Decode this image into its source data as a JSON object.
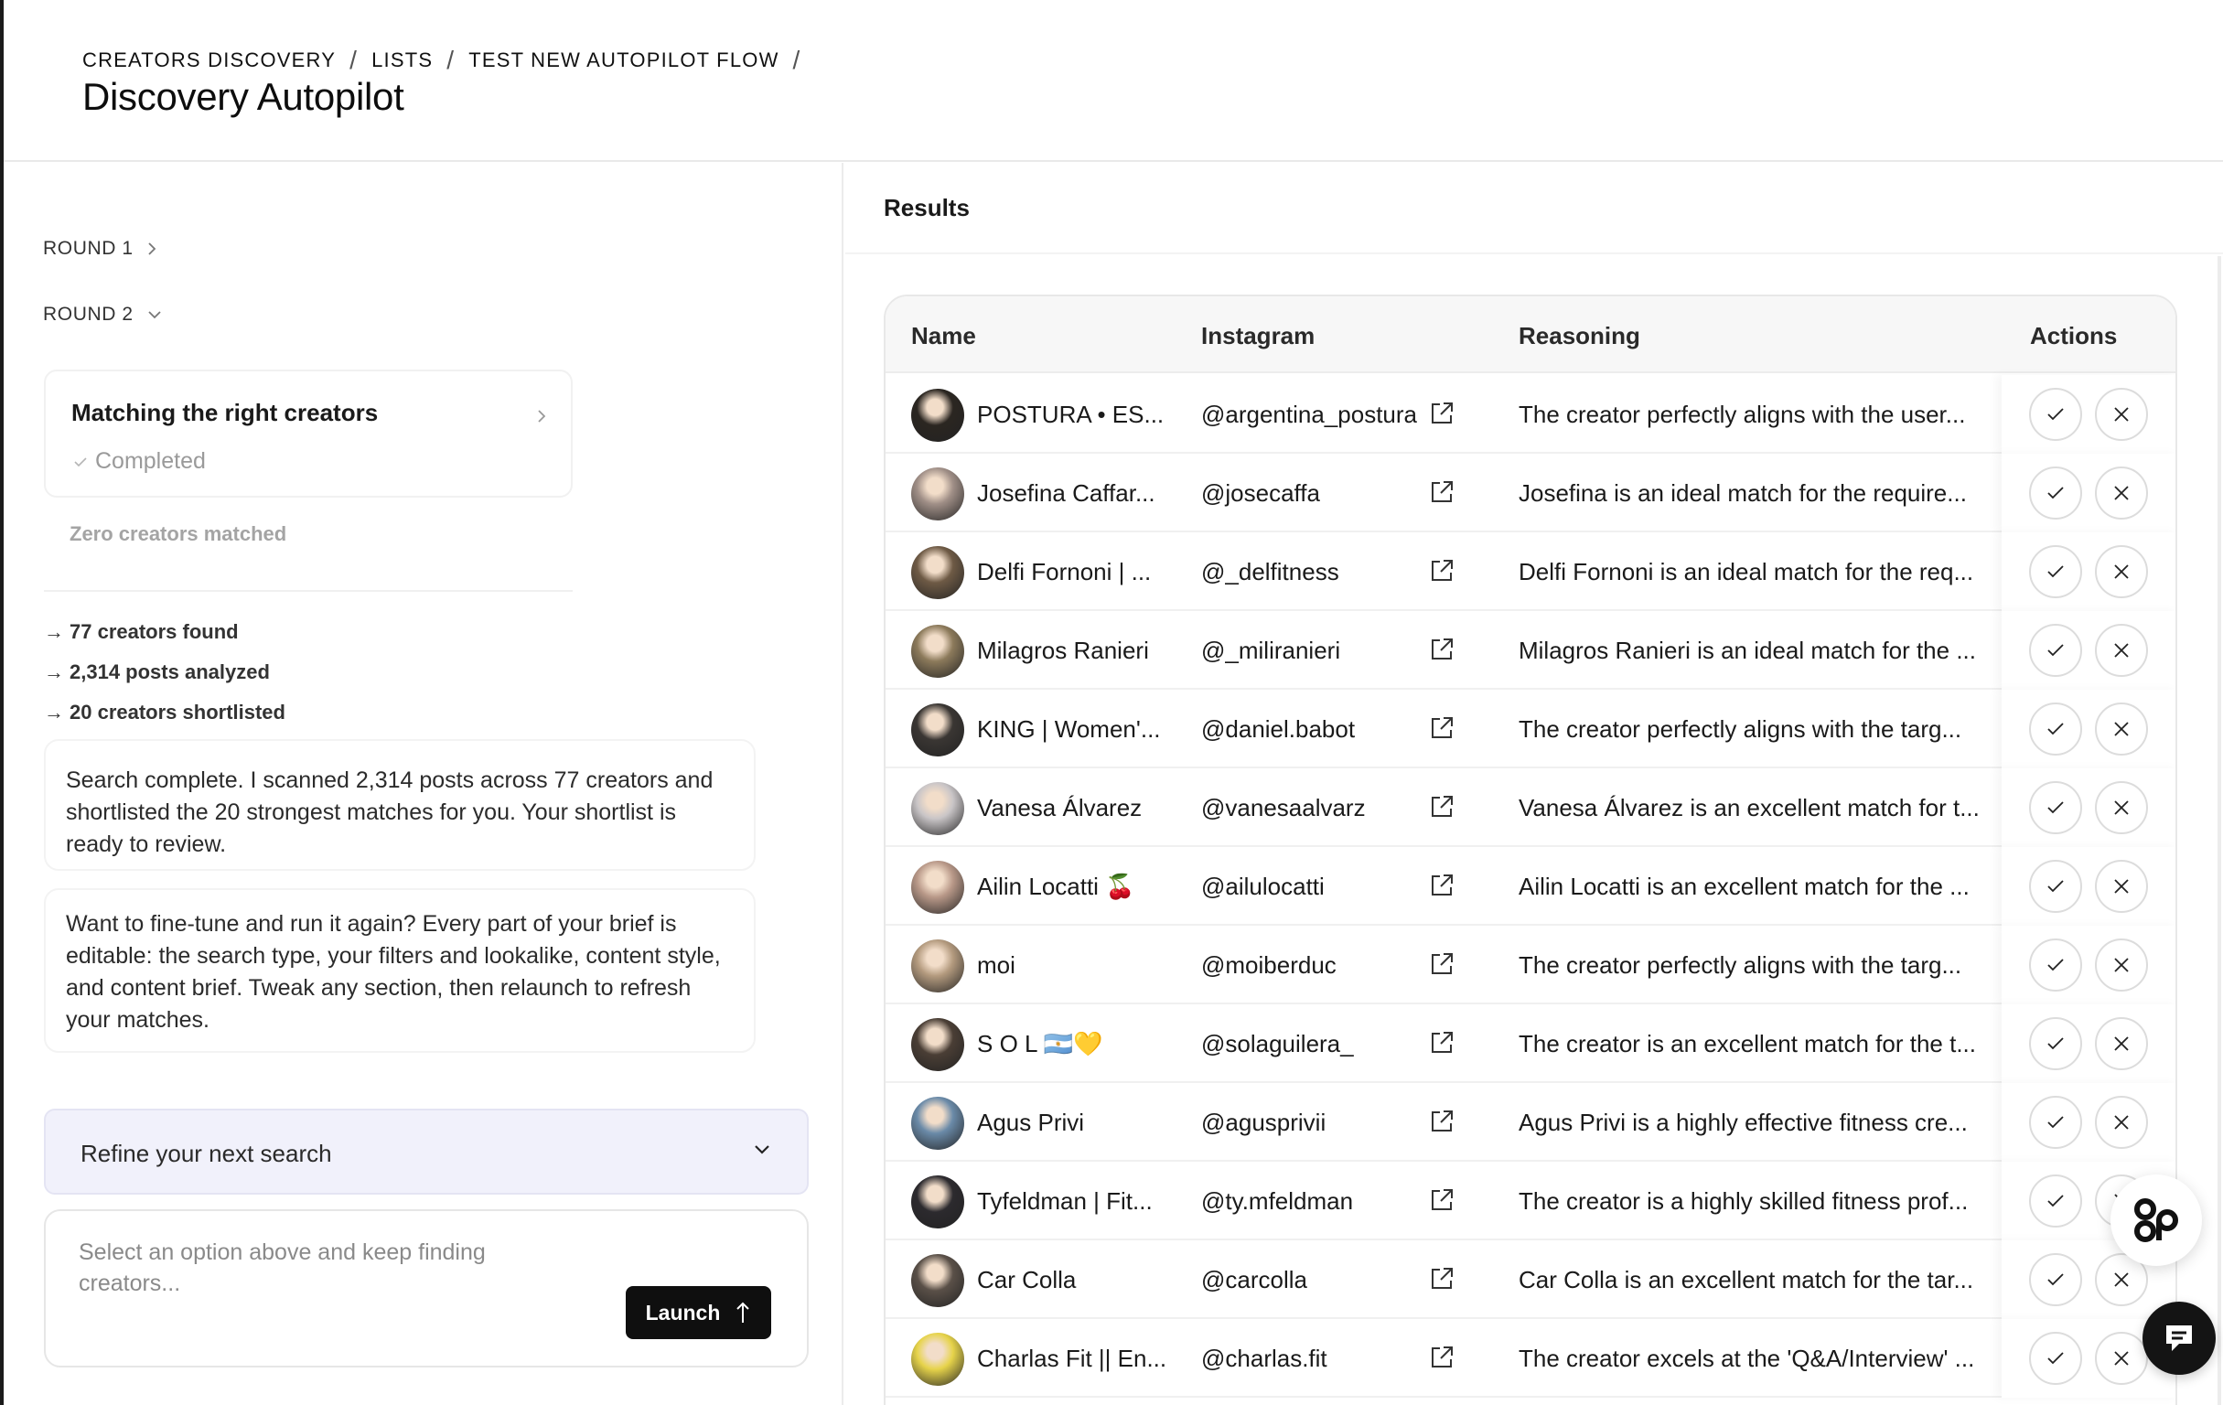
{
  "breadcrumb": [
    "CREATORS DISCOVERY",
    "LISTS",
    "TEST NEW AUTOPILOT FLOW"
  ],
  "breadcrumb_separator": "/",
  "page_title": "Discovery Autopilot",
  "rounds": [
    {
      "label": "ROUND 1",
      "expanded": false
    },
    {
      "label": "ROUND 2",
      "expanded": true
    }
  ],
  "matching_card": {
    "title": "Matching the right creators",
    "status": "Completed"
  },
  "zero_matched": "Zero creators matched",
  "stats": [
    "77 creators found",
    "2,314 posts analyzed",
    "20 creators shortlisted"
  ],
  "messages": [
    "Search complete. I scanned 2,314 posts across 77 creators and shortlisted the 20 strongest matches for you. Your shortlist is ready to review.",
    "Want to fine-tune and run it again? Every part of your brief is editable: the search type, your filters and lookalike, content style, and content brief. Tweak any section, then relaunch to refresh your matches."
  ],
  "refine": {
    "label": "Refine your next search"
  },
  "composer": {
    "placeholder": "Select an option above and keep finding creators...",
    "launch_label": "Launch"
  },
  "results": {
    "title": "Results",
    "columns": [
      "Name",
      "Instagram",
      "Reasoning",
      "Actions"
    ],
    "rows": [
      {
        "name": "POSTURA • ES...",
        "instagram": "@argentina_postura",
        "reasoning": "The creator perfectly aligns with the user...",
        "avatar_color": "#2b2621"
      },
      {
        "name": "Josefina Caffar...",
        "instagram": "@josecaffa",
        "reasoning": "Josefina is an ideal match for the require...",
        "avatar_color": "#a08f87"
      },
      {
        "name": "Delfi Fornoni | ...",
        "instagram": "@_delfitness",
        "reasoning": "Delfi Fornoni is an ideal match for the req...",
        "avatar_color": "#6e5a45"
      },
      {
        "name": "Milagros Ranieri",
        "instagram": "@_miliranieri",
        "reasoning": "Milagros Ranieri is an ideal match for the ...",
        "avatar_color": "#8c7a5b"
      },
      {
        "name": "KING | Women'...",
        "instagram": "@daniel.babot",
        "reasoning": "The creator perfectly aligns with the targ...",
        "avatar_color": "#3a3633"
      },
      {
        "name": "Vanesa Álvarez",
        "instagram": "@vanesaalvarz",
        "reasoning": "Vanesa Álvarez is an excellent match for t...",
        "avatar_color": "#c9c5c7"
      },
      {
        "name": "Ailin Locatti 🍒",
        "instagram": "@ailulocatti",
        "reasoning": "Ailin Locatti is an excellent match for the ...",
        "avatar_color": "#b89888"
      },
      {
        "name": "moi",
        "instagram": "@moiberduc",
        "reasoning": "The creator perfectly aligns with the targ...",
        "avatar_color": "#b39a7e"
      },
      {
        "name": "S O L 🇦🇷💛",
        "instagram": "@solaguilera_",
        "reasoning": "The creator is an excellent match for the t...",
        "avatar_color": "#4a3e35"
      },
      {
        "name": "Agus Privi",
        "instagram": "@agusprivii",
        "reasoning": "Agus Privi is a highly effective fitness cre...",
        "avatar_color": "#6a8aa8"
      },
      {
        "name": "Tyfeldman | Fit...",
        "instagram": "@ty.mfeldman",
        "reasoning": "The creator is a highly skilled fitness prof...",
        "avatar_color": "#2c2a2e"
      },
      {
        "name": "Car Colla",
        "instagram": "@carcolla",
        "reasoning": "Car Colla is an excellent match for the tar...",
        "avatar_color": "#5a5048"
      },
      {
        "name": "Charlas Fit || En...",
        "instagram": "@charlas.fit",
        "reasoning": "The creator excels at the 'Q&A/Interview' ...",
        "avatar_color": "#e6d34a"
      }
    ]
  },
  "colors": {
    "accent_dark": "#0f0f0f",
    "refine_bg": "#f1f1fb",
    "muted_text": "#9a9a9a"
  }
}
